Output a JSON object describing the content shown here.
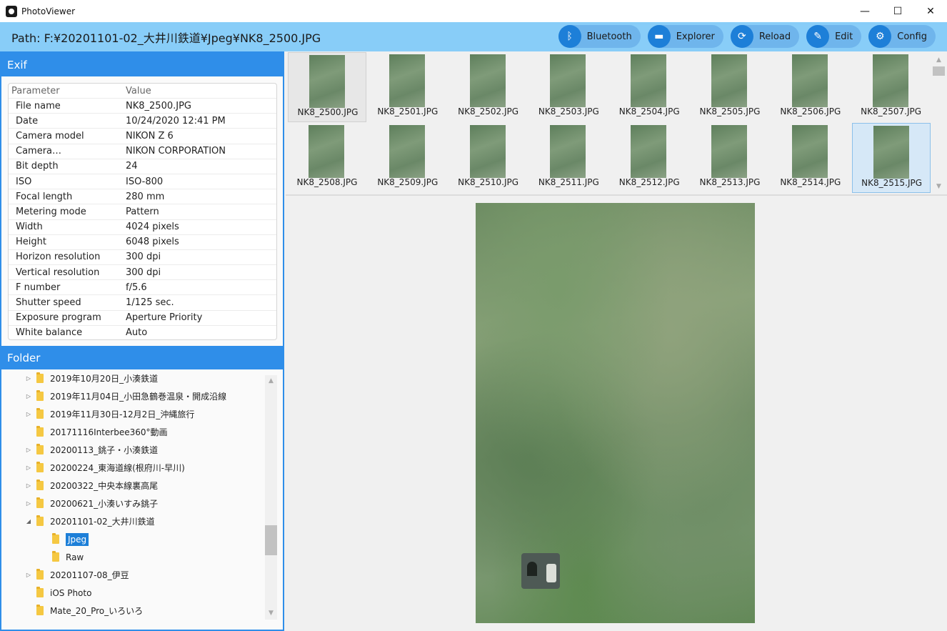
{
  "window": {
    "title": "PhotoViewer"
  },
  "path": {
    "label": "Path: F:¥20201101-02_大井川鉄道¥Jpeg¥NK8_2500.JPG"
  },
  "toolbar": [
    {
      "label": "Bluetooth",
      "icon": "bluetooth-icon",
      "glyph": "ᛒ"
    },
    {
      "label": "Explorer",
      "icon": "folder-icon",
      "glyph": "▬"
    },
    {
      "label": "Reload",
      "icon": "reload-icon",
      "glyph": "⟳"
    },
    {
      "label": "Edit",
      "icon": "edit-icon",
      "glyph": "✎"
    },
    {
      "label": "Config",
      "icon": "gear-icon",
      "glyph": "⚙"
    }
  ],
  "exif": {
    "title": "Exif",
    "header": {
      "param": "Parameter",
      "value": "Value"
    },
    "rows": [
      {
        "p": "File name",
        "v": "NK8_2500.JPG"
      },
      {
        "p": "Date",
        "v": "10/24/2020 12:41 PM"
      },
      {
        "p": "Camera model",
        "v": "NIKON Z 6"
      },
      {
        "p": "Camera…",
        "v": "NIKON CORPORATION"
      },
      {
        "p": "Bit depth",
        "v": "24"
      },
      {
        "p": "ISO",
        "v": "ISO-800"
      },
      {
        "p": "Focal length",
        "v": "280 mm"
      },
      {
        "p": "Metering mode",
        "v": "Pattern"
      },
      {
        "p": "Width",
        "v": "4024 pixels"
      },
      {
        "p": "Height",
        "v": "6048 pixels"
      },
      {
        "p": "Horizon resolution",
        "v": "300 dpi"
      },
      {
        "p": "Vertical resolution",
        "v": "300 dpi"
      },
      {
        "p": "F number",
        "v": "f/5.6"
      },
      {
        "p": "Shutter speed",
        "v": "1/125 sec."
      },
      {
        "p": "Exposure program",
        "v": "Aperture Priority"
      },
      {
        "p": "White balance",
        "v": "Auto"
      }
    ]
  },
  "folder": {
    "title": "Folder",
    "items": [
      {
        "label": "2019年10月20日_小湊鉄道",
        "expander": "▷",
        "level": 0
      },
      {
        "label": "2019年11月04日_小田急鶴巻温泉・開成沿線",
        "expander": "▷",
        "level": 0
      },
      {
        "label": "2019年11月30日-12月2日_沖縄旅行",
        "expander": "▷",
        "level": 0
      },
      {
        "label": "20171116Interbee360°動画",
        "expander": "",
        "level": 0
      },
      {
        "label": "20200113_銚子・小湊鉄道",
        "expander": "▷",
        "level": 0
      },
      {
        "label": "20200224_東海道線(根府川-早川)",
        "expander": "▷",
        "level": 0
      },
      {
        "label": "20200322_中央本線裏高尾",
        "expander": "▷",
        "level": 0
      },
      {
        "label": "20200621_小湊いすみ銚子",
        "expander": "▷",
        "level": 0
      },
      {
        "label": "20201101-02_大井川鉄道",
        "expander": "◢",
        "level": 0
      },
      {
        "label": "Jpeg",
        "expander": "",
        "level": 1,
        "selected": true
      },
      {
        "label": "Raw",
        "expander": "",
        "level": 1
      },
      {
        "label": "20201107-08_伊豆",
        "expander": "▷",
        "level": 0
      },
      {
        "label": "iOS Photo",
        "expander": "",
        "level": 0
      },
      {
        "label": "Mate_20_Pro_いろいろ",
        "expander": "",
        "level": 0
      }
    ]
  },
  "thumbnails": [
    "NK8_2500.JPG",
    "NK8_2501.JPG",
    "NK8_2502.JPG",
    "NK8_2503.JPG",
    "NK8_2504.JPG",
    "NK8_2505.JPG",
    "NK8_2506.JPG",
    "NK8_2507.JPG",
    "NK8_2508.JPG",
    "NK8_2509.JPG",
    "NK8_2510.JPG",
    "NK8_2511.JPG",
    "NK8_2512.JPG",
    "NK8_2513.JPG",
    "NK8_2514.JPG",
    "NK8_2515.JPG"
  ],
  "window_buttons": {
    "minimize": "—",
    "maximize": "☐",
    "close": "✕"
  },
  "scroll": {
    "up": "▲",
    "down": "▼"
  }
}
